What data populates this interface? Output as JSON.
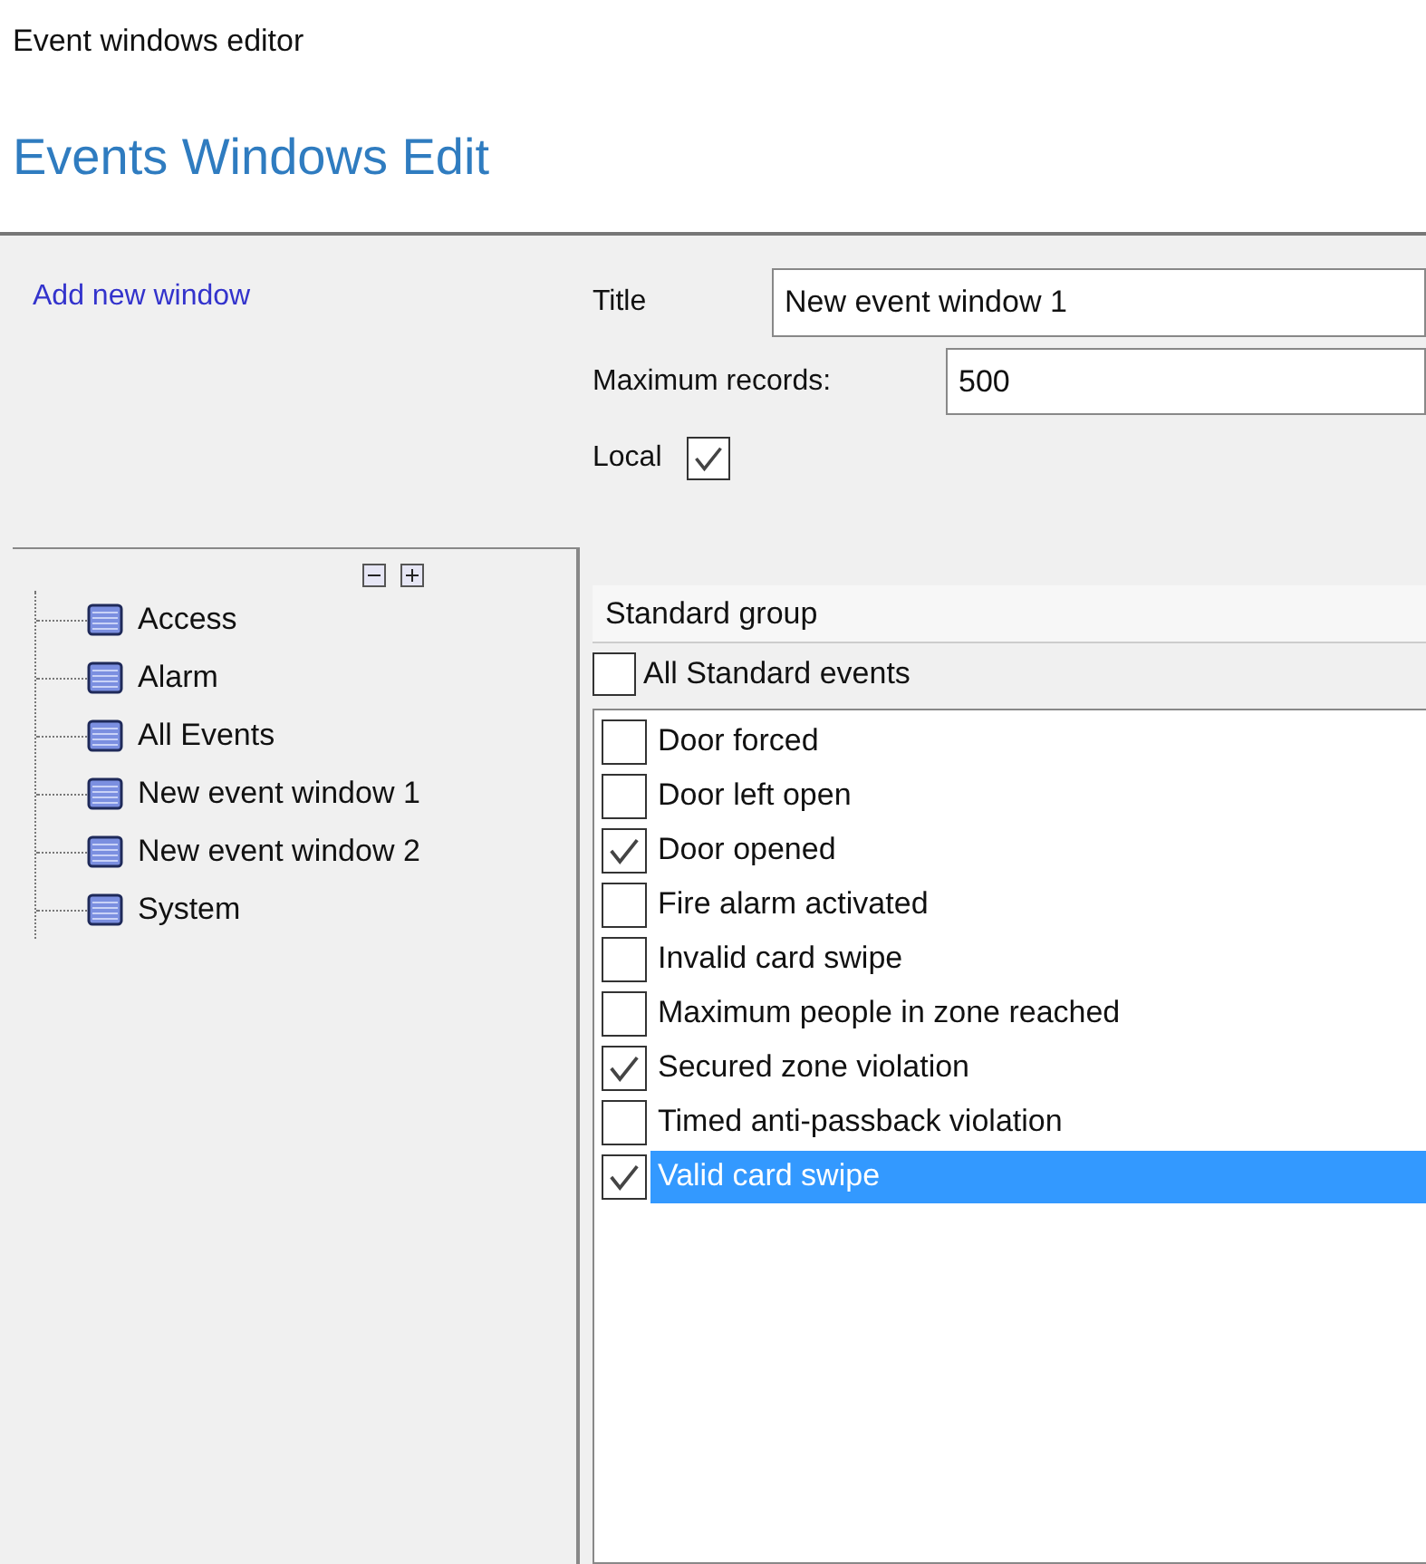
{
  "window": {
    "title": "Event windows editor"
  },
  "heading": "Events Windows Edit",
  "add_link": "Add new window",
  "form": {
    "title_label": "Title",
    "title_value": "New event window 1",
    "max_label": "Maximum records:",
    "max_value": "500",
    "local_label": "Local",
    "local_checked": true
  },
  "tree": {
    "items": [
      {
        "label": "Access"
      },
      {
        "label": "Alarm"
      },
      {
        "label": "All Events"
      },
      {
        "label": "New event window 1"
      },
      {
        "label": "New event window 2"
      },
      {
        "label": "System"
      }
    ]
  },
  "group": {
    "header": "Standard group",
    "all_label": "All Standard events",
    "all_checked": false
  },
  "events": [
    {
      "label": "Door forced",
      "checked": false,
      "selected": false
    },
    {
      "label": "Door left open",
      "checked": false,
      "selected": false
    },
    {
      "label": "Door opened",
      "checked": true,
      "selected": false
    },
    {
      "label": "Fire alarm activated",
      "checked": false,
      "selected": false
    },
    {
      "label": "Invalid card swipe",
      "checked": false,
      "selected": false
    },
    {
      "label": "Maximum people in zone reached",
      "checked": false,
      "selected": false
    },
    {
      "label": "Secured zone violation",
      "checked": true,
      "selected": false
    },
    {
      "label": "Timed anti-passback violation",
      "checked": false,
      "selected": false
    },
    {
      "label": "Valid card swipe",
      "checked": true,
      "selected": true
    }
  ]
}
